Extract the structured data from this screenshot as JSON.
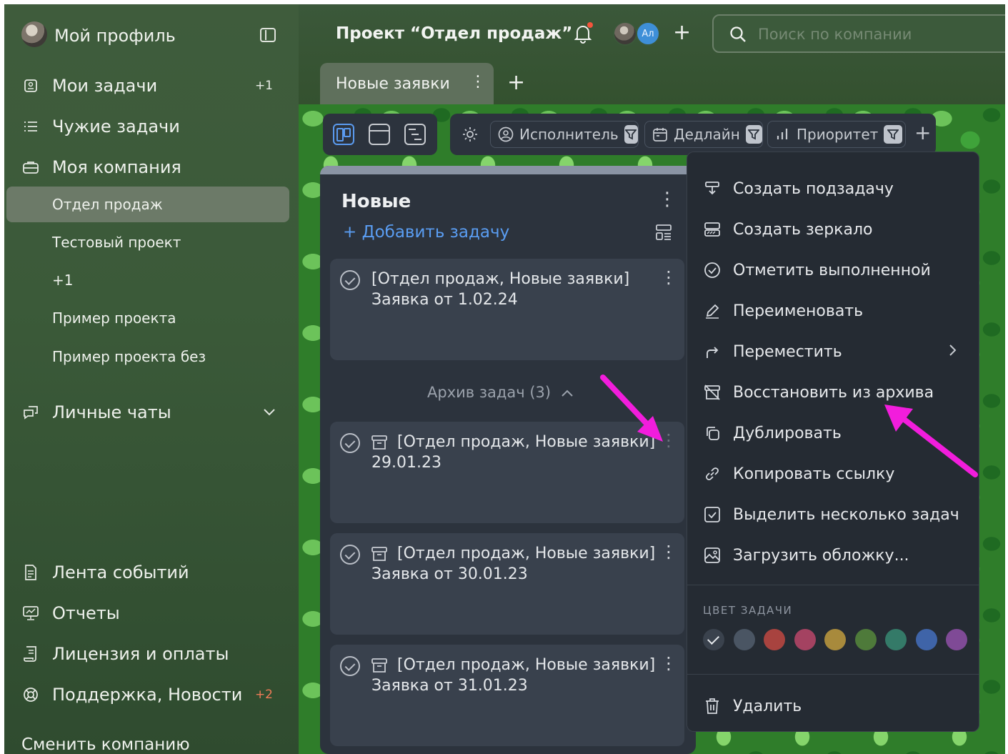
{
  "sidebar": {
    "profile_label": "Мой профиль",
    "items": [
      {
        "label": "Мои задачи",
        "badge": "+1",
        "icon": "task-list-icon"
      },
      {
        "label": "Чужие задачи",
        "icon": "list-icon"
      },
      {
        "label": "Моя компания",
        "icon": "briefcase-icon"
      }
    ],
    "projects": [
      {
        "label": "Отдел продаж",
        "active": true
      },
      {
        "label": "Тестовый проект"
      },
      {
        "label": "+1"
      },
      {
        "label": "Пример проекта"
      },
      {
        "label": "Пример проекта без"
      }
    ],
    "chats_label": "Личные чаты",
    "bottom_items": [
      {
        "label": "Лента событий",
        "icon": "feed-icon"
      },
      {
        "label": "Отчеты",
        "icon": "reports-icon"
      },
      {
        "label": "Лицензия и оплаты",
        "icon": "license-icon"
      },
      {
        "label": "Поддержка, Новости",
        "badge": "+2",
        "icon": "lifebuoy-icon"
      }
    ],
    "switch_company": "Сменить компанию"
  },
  "header": {
    "project_title": "Проект “Отдел продаж”",
    "avatar_initials": "Ал",
    "search_placeholder": "Поиск по компании"
  },
  "tabs": [
    {
      "label": "Новые заявки",
      "active": true
    }
  ],
  "filters": [
    {
      "label": "Исполнитель",
      "icon": "user-icon"
    },
    {
      "label": "Дедлайн",
      "icon": "calendar-icon"
    },
    {
      "label": "Приоритет",
      "icon": "bars-icon"
    }
  ],
  "column": {
    "title": "Новые",
    "add_task": "Добавить задачу",
    "cards": [
      {
        "text": "[Отдел продаж, Новые заявки] Заявка от 1.02.24",
        "archived": false
      }
    ],
    "archive_toggle": "Архив задач (3)",
    "archived_cards": [
      {
        "text": "[Отдел продаж, Новые заявки] 29.01.23"
      },
      {
        "text": "[Отдел продаж, Новые заявки] Заявка от 30.01.23"
      },
      {
        "text": "[Отдел продаж, Новые заявки] Заявка от 31.01.23"
      }
    ]
  },
  "context_menu": {
    "items": [
      {
        "label": "Создать подзадачу",
        "icon": "subtask-icon"
      },
      {
        "label": "Создать зеркало",
        "icon": "mirror-icon"
      },
      {
        "label": "Отметить выполненной",
        "icon": "check-circle-icon"
      },
      {
        "label": "Переименовать",
        "icon": "edit-icon"
      },
      {
        "label": "Переместить",
        "icon": "move-icon",
        "submenu": true
      },
      {
        "label": "Восстановить из архива",
        "icon": "unarchive-icon"
      },
      {
        "label": "Дублировать",
        "icon": "duplicate-icon"
      },
      {
        "label": "Копировать ссылку",
        "icon": "link-icon"
      },
      {
        "label": "Выделить несколько задач",
        "icon": "multi-select-icon"
      },
      {
        "label": "Загрузить обложку...",
        "icon": "image-icon"
      }
    ],
    "color_title": "ЦВЕТ ЗАДАЧИ",
    "colors": [
      "#3a424d",
      "#4a5563",
      "#a8433f",
      "#a44261",
      "#a88a3c",
      "#4e7a3a",
      "#347a68",
      "#3f64a8",
      "#7f4a96"
    ],
    "delete_label": "Удалить"
  },
  "colors": {
    "accent": "#5a9df2",
    "annotation_arrow": "#f21ddc",
    "danger_badge": "#ef7b57"
  }
}
